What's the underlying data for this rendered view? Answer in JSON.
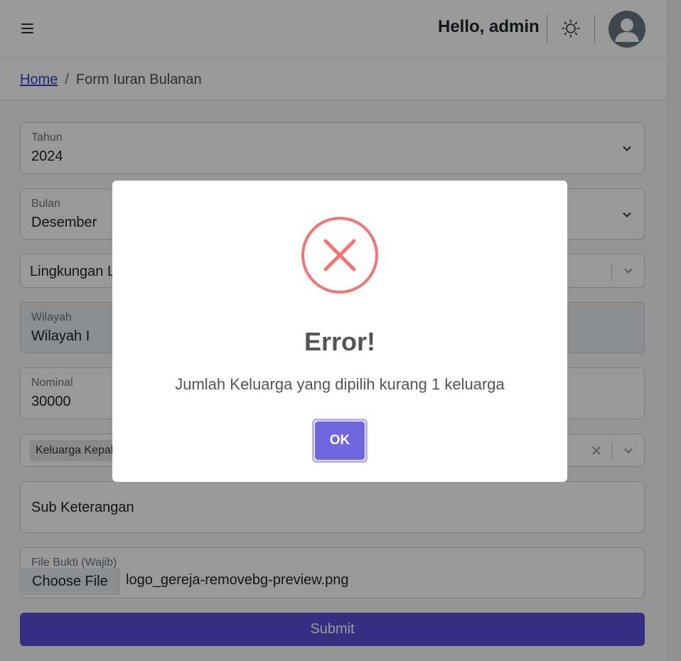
{
  "header": {
    "greeting": "Hello, admin"
  },
  "breadcrumb": {
    "home": "Home",
    "separator": "/",
    "current": "Form Iuran Bulanan"
  },
  "form": {
    "tahun": {
      "label": "Tahun",
      "value": "2024"
    },
    "bulan": {
      "label": "Bulan",
      "value": "Desember"
    },
    "lingkungan": {
      "value": "Lingkungan L"
    },
    "wilayah": {
      "label": "Wilayah",
      "value": "Wilayah I"
    },
    "nominal": {
      "label": "Nominal",
      "value": "30000"
    },
    "keluarga": {
      "tag": "Keluarga Kepal"
    },
    "sub_keterangan": {
      "placeholder": "Sub Keterangan"
    },
    "file_bukti": {
      "label": "File Bukti (Wajib)",
      "button": "Choose File",
      "filename": "logo_gereja-removebg-preview.png"
    },
    "submit": "Submit"
  },
  "modal": {
    "title": "Error!",
    "message": "Jumlah Keluarga yang dipilih kurang 1 keluarga",
    "ok": "OK"
  },
  "colors": {
    "primary": "#5b4fd8",
    "ok_button": "#7066e0",
    "error": "#f27474"
  },
  "icons": {
    "menu": "hamburger-icon",
    "theme": "sun-icon",
    "avatar": "user-avatar-icon",
    "chevron": "chevron-down-icon",
    "clear": "close-icon",
    "error": "error-x-icon"
  }
}
